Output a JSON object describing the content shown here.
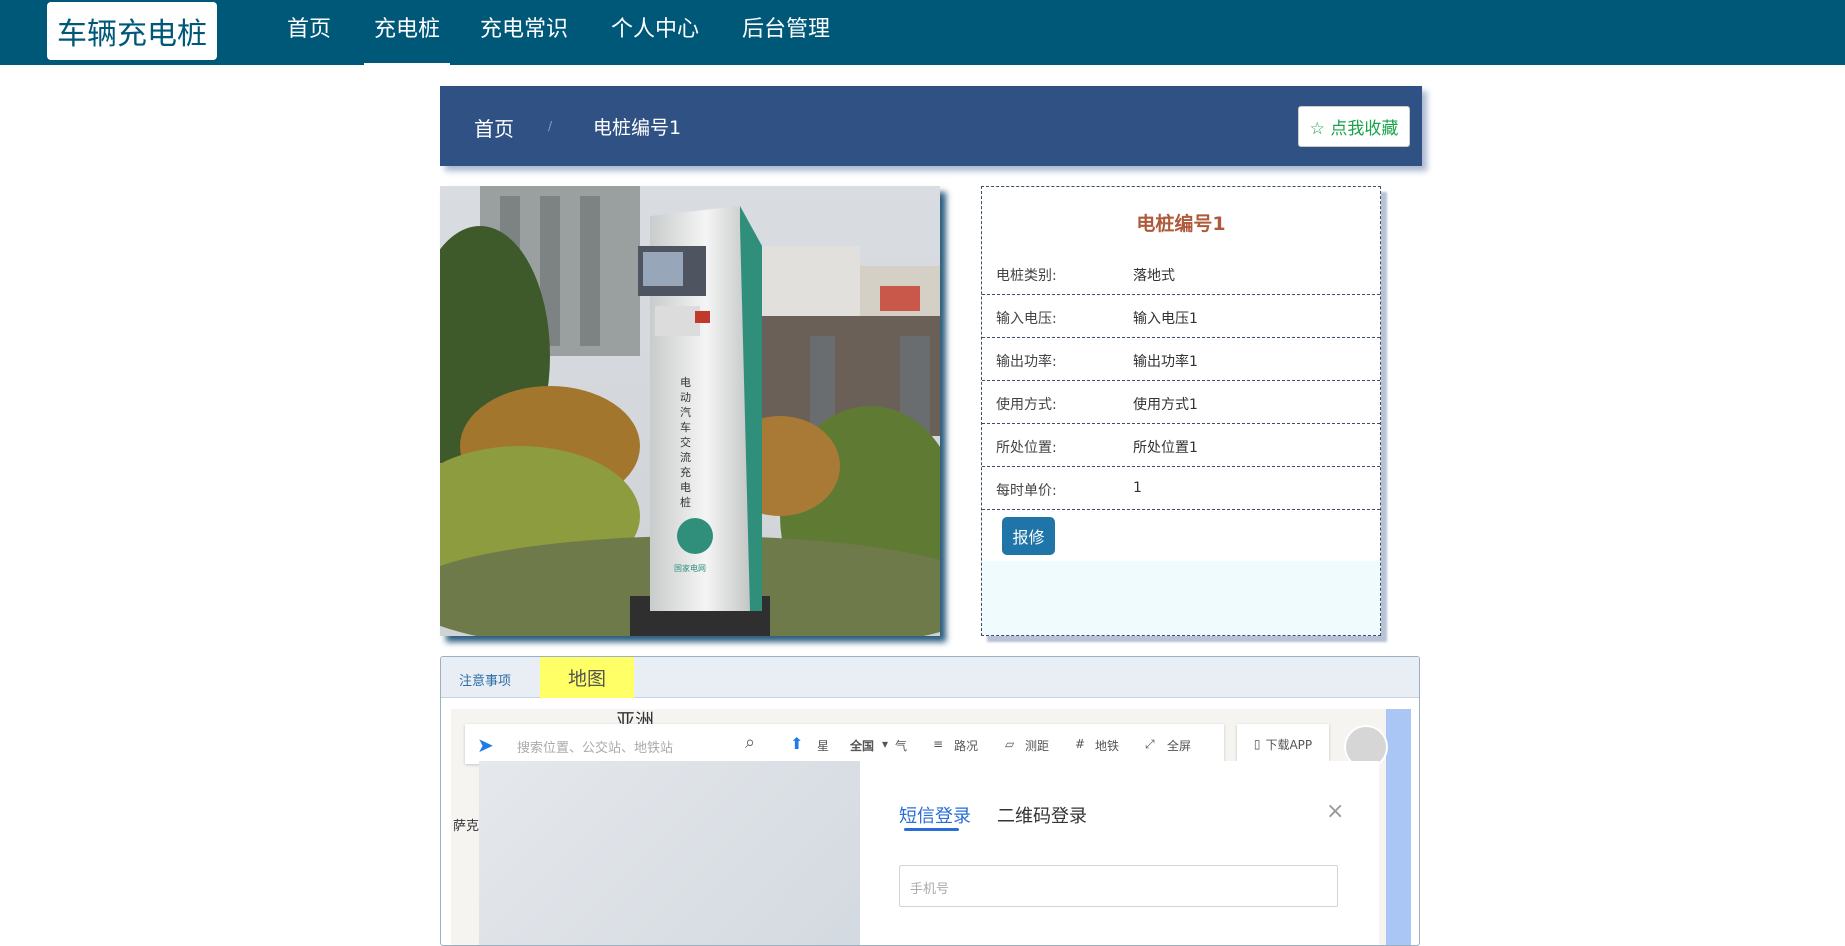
{
  "nav": {
    "logo": "车辆充电桩",
    "items": [
      "首页",
      "充电桩",
      "充电常识",
      "个人中心",
      "后台管理"
    ],
    "active_index": 1
  },
  "breadcrumb": {
    "home": "首页",
    "separator": "/",
    "current": "电桩编号1",
    "fav_label": "☆ 点我收藏"
  },
  "detail": {
    "title": "电桩编号1",
    "rows": [
      {
        "key": "电桩类别:",
        "value": "落地式"
      },
      {
        "key": "输入电压:",
        "value": "输入电压1"
      },
      {
        "key": "输出功率:",
        "value": "输出功率1"
      },
      {
        "key": "使用方式:",
        "value": "使用方式1"
      },
      {
        "key": "所处位置:",
        "value": "所处位置1"
      },
      {
        "key": "每时单价:",
        "value": "1"
      }
    ],
    "repair_label": "报修"
  },
  "photo": {
    "sign_text": "电动汽车交流充电桩",
    "brand": "国家电网"
  },
  "tabs": {
    "notice": "注意事项",
    "map": "地图"
  },
  "map": {
    "search_placeholder": "搜索位置、公交站、地铁站",
    "tools": [
      "星",
      "全国",
      "气",
      "路况",
      "测距",
      "地铁",
      "全屏"
    ],
    "download": "下载APP",
    "labels": [
      "亚洲",
      "萨克"
    ],
    "login": {
      "tab_sms": "短信登录",
      "tab_qr": "二维码登录",
      "close": "×",
      "phone_placeholder": "手机号"
    }
  },
  "colors": {
    "nav_bg": "#005879",
    "crumb_bg": "#2f5183",
    "title_color": "#b05a3c",
    "repair_bg": "#1f74a8",
    "tab_active_bg": "#ffff66"
  }
}
